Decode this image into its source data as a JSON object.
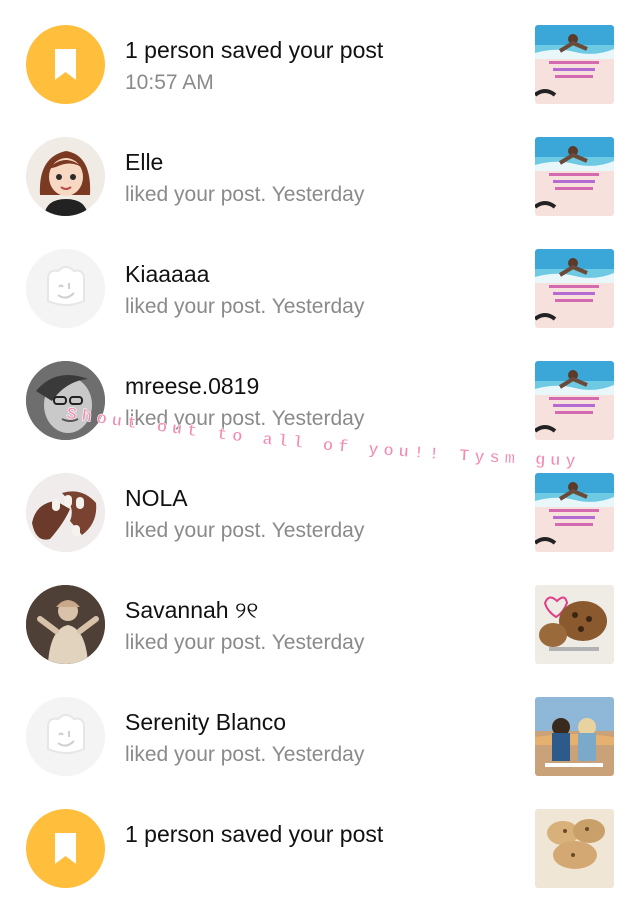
{
  "notifications": [
    {
      "avatar": "bookmark-icon",
      "title": "1 person saved your post",
      "subtitle": "10:57 AM",
      "thumb": "beach-post"
    },
    {
      "avatar": "cartoon-girl-avatar",
      "title": "Elle",
      "subtitle": "liked your post. Yesterday",
      "thumb": "beach-post"
    },
    {
      "avatar": "default-sticker-avatar",
      "title": "Kiaaaaa",
      "subtitle": "liked your post. Yesterday",
      "thumb": "beach-post"
    },
    {
      "avatar": "bw-photo-avatar",
      "title": "mreese.0819",
      "subtitle": "liked your post. Yesterday",
      "thumb": "beach-post"
    },
    {
      "avatar": "hands-photo-avatar",
      "title": "NOLA",
      "subtitle": "liked your post. Yesterday",
      "thumb": "beach-post"
    },
    {
      "avatar": "person-photo-avatar",
      "title": "Savannah ୨୧",
      "subtitle": "liked your post. Yesterday",
      "thumb": "cookie-post"
    },
    {
      "avatar": "default-sticker-avatar",
      "title": "Serenity Blanco",
      "subtitle": "liked your post. Yesterday",
      "thumb": "sunset-post"
    },
    {
      "avatar": "bookmark-icon",
      "title": "1 person saved your post",
      "subtitle": "",
      "thumb": "cookies-post"
    }
  ],
  "overlay_text": "Shout out to all of you!! Tysm guys!!!",
  "colors": {
    "accent": "#FFBE3B",
    "overlay": "#F28AB3",
    "subtext": "#8A8A8A"
  }
}
